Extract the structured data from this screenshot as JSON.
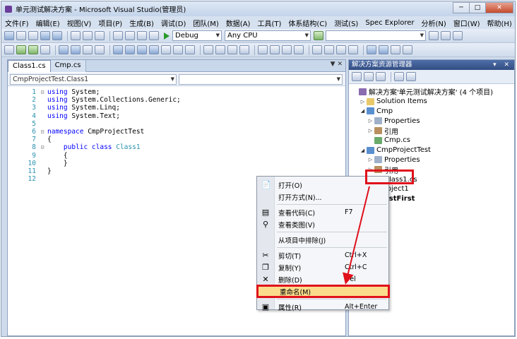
{
  "window": {
    "title": "单元测试解决方案 - Microsoft Visual Studio(管理员)",
    "buttons": [
      "─",
      "□",
      "✕"
    ]
  },
  "menubar": [
    "文件(F)",
    "编辑(E)",
    "视图(V)",
    "项目(P)",
    "生成(B)",
    "调试(D)",
    "团队(M)",
    "数据(A)",
    "工具(T)",
    "体系结构(C)",
    "测试(S)",
    "Spec Explorer",
    "分析(N)",
    "窗口(W)",
    "帮助(H)"
  ],
  "toolbar": {
    "config": "Debug",
    "platform": "Any CPU",
    "find": ""
  },
  "editor": {
    "tabs": [
      "Class1.cs",
      "Cmp.cs"
    ],
    "tabs_controls": "▼ ✕",
    "nav_left": "CmpProjectTest.Class1",
    "nav_right": "",
    "lines": [
      {
        "n": "1",
        "fold": "⊟",
        "kw": "using",
        "rest": " System;"
      },
      {
        "n": "2",
        "fold": "",
        "kw": "using",
        "rest": " System.Collections.Generic;"
      },
      {
        "n": "3",
        "fold": "",
        "kw": "using",
        "rest": " System.Linq;"
      },
      {
        "n": "4",
        "fold": "",
        "kw": "using",
        "rest": " System.Text;"
      },
      {
        "n": "5",
        "fold": "",
        "kw": "",
        "rest": ""
      },
      {
        "n": "6",
        "fold": "⊟",
        "kw": "namespace",
        "rest": " CmpProjectTest"
      },
      {
        "n": "7",
        "fold": "",
        "kw": "",
        "rest": "{"
      },
      {
        "n": "8",
        "fold": "⊟",
        "kw": "    public class",
        "cls": " Class1",
        "rest": ""
      },
      {
        "n": "9",
        "fold": "",
        "kw": "",
        "rest": "    {"
      },
      {
        "n": "10",
        "fold": "",
        "kw": "",
        "rest": "    }"
      },
      {
        "n": "11",
        "fold": "",
        "kw": "",
        "rest": "}"
      },
      {
        "n": "12",
        "fold": "",
        "kw": "",
        "rest": ""
      }
    ]
  },
  "solution_explorer": {
    "title": "解决方案资源管理器",
    "title_buttons": "▾ ✕",
    "nodes": [
      {
        "label": "解决方案'单元测试解决方案' (4 个项目)",
        "indent": 0,
        "exp": "",
        "icon": "sol"
      },
      {
        "label": "Solution Items",
        "indent": 1,
        "exp": "▷",
        "icon": "fld"
      },
      {
        "label": "Cmp",
        "indent": 1,
        "exp": "◢",
        "icon": "proj"
      },
      {
        "label": "Properties",
        "indent": 2,
        "exp": "▷",
        "icon": "prop"
      },
      {
        "label": "引用",
        "indent": 2,
        "exp": "▷",
        "icon": "ref"
      },
      {
        "label": "Cmp.cs",
        "indent": 2,
        "exp": "",
        "icon": "cs"
      },
      {
        "label": "CmpProjectTest",
        "indent": 1,
        "exp": "◢",
        "icon": "proj"
      },
      {
        "label": "Properties",
        "indent": 2,
        "exp": "▷",
        "icon": "prop"
      },
      {
        "label": "引用",
        "indent": 2,
        "exp": "▷",
        "icon": "ref"
      },
      {
        "label": "Class1.cs",
        "indent": 2,
        "exp": "",
        "icon": "cs"
      },
      {
        "label": "roject1",
        "indent": 3,
        "exp": "",
        "icon": ""
      },
      {
        "label": "estFirst",
        "indent": 3,
        "exp": "",
        "icon": "",
        "bold": true
      }
    ]
  },
  "context_menu": {
    "items": [
      {
        "icon": "📄",
        "label": "打开(O)",
        "key": ""
      },
      {
        "icon": "",
        "label": "打开方式(N)...",
        "key": ""
      },
      {
        "sep": true
      },
      {
        "icon": "▤",
        "label": "查看代码(C)",
        "key": "F7"
      },
      {
        "icon": "⚲",
        "label": "查看类图(V)",
        "key": ""
      },
      {
        "sep": true
      },
      {
        "icon": "",
        "label": "从项目中排除(J)",
        "key": ""
      },
      {
        "sep": true
      },
      {
        "icon": "✂",
        "label": "剪切(T)",
        "key": "Ctrl+X"
      },
      {
        "icon": "❐",
        "label": "复制(Y)",
        "key": "Ctrl+C"
      },
      {
        "icon": "✕",
        "label": "删除(D)",
        "key": "Del"
      },
      {
        "icon": "",
        "label": "重命名(M)",
        "key": "",
        "highlight": true
      },
      {
        "sep": true
      },
      {
        "icon": "▣",
        "label": "属性(R)",
        "key": "Alt+Enter"
      }
    ]
  },
  "colors": {
    "annotation": "#e0111b",
    "highlight": "#fbdc8c",
    "panel_title": "#324d83"
  }
}
